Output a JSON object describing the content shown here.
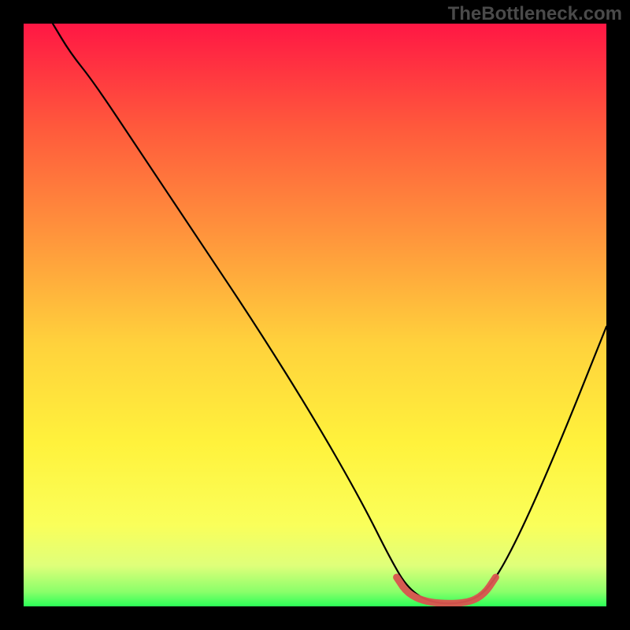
{
  "watermark": "TheBottleneck.com",
  "chart_data": {
    "type": "line",
    "title": "",
    "xlabel": "",
    "ylabel": "",
    "xlim": [
      0,
      100
    ],
    "ylim": [
      0,
      100
    ],
    "grid": false,
    "series": [
      {
        "name": "curve",
        "color": "#000000",
        "points": [
          {
            "x": 5,
            "y": 100
          },
          {
            "x": 8,
            "y": 95
          },
          {
            "x": 12,
            "y": 90
          },
          {
            "x": 20,
            "y": 78
          },
          {
            "x": 30,
            "y": 63
          },
          {
            "x": 40,
            "y": 48
          },
          {
            "x": 50,
            "y": 32
          },
          {
            "x": 58,
            "y": 18
          },
          {
            "x": 63,
            "y": 8
          },
          {
            "x": 66,
            "y": 3
          },
          {
            "x": 70,
            "y": 0.5
          },
          {
            "x": 76,
            "y": 0.5
          },
          {
            "x": 80,
            "y": 3
          },
          {
            "x": 85,
            "y": 12
          },
          {
            "x": 92,
            "y": 28
          },
          {
            "x": 100,
            "y": 48
          }
        ]
      },
      {
        "name": "min-highlight",
        "color": "#d9534f",
        "points": [
          {
            "x": 64,
            "y": 5
          },
          {
            "x": 66,
            "y": 2
          },
          {
            "x": 70,
            "y": 0.5
          },
          {
            "x": 76,
            "y": 0.5
          },
          {
            "x": 79,
            "y": 2
          },
          {
            "x": 81,
            "y": 5
          }
        ]
      }
    ],
    "gradient_stops": [
      {
        "offset": 0.0,
        "color": "#ff1744"
      },
      {
        "offset": 0.18,
        "color": "#ff5a3c"
      },
      {
        "offset": 0.38,
        "color": "#ff9a3c"
      },
      {
        "offset": 0.55,
        "color": "#ffd23c"
      },
      {
        "offset": 0.72,
        "color": "#fff23c"
      },
      {
        "offset": 0.86,
        "color": "#faff5a"
      },
      {
        "offset": 0.93,
        "color": "#dfff7a"
      },
      {
        "offset": 0.975,
        "color": "#8aff6a"
      },
      {
        "offset": 1.0,
        "color": "#2bff57"
      }
    ]
  }
}
